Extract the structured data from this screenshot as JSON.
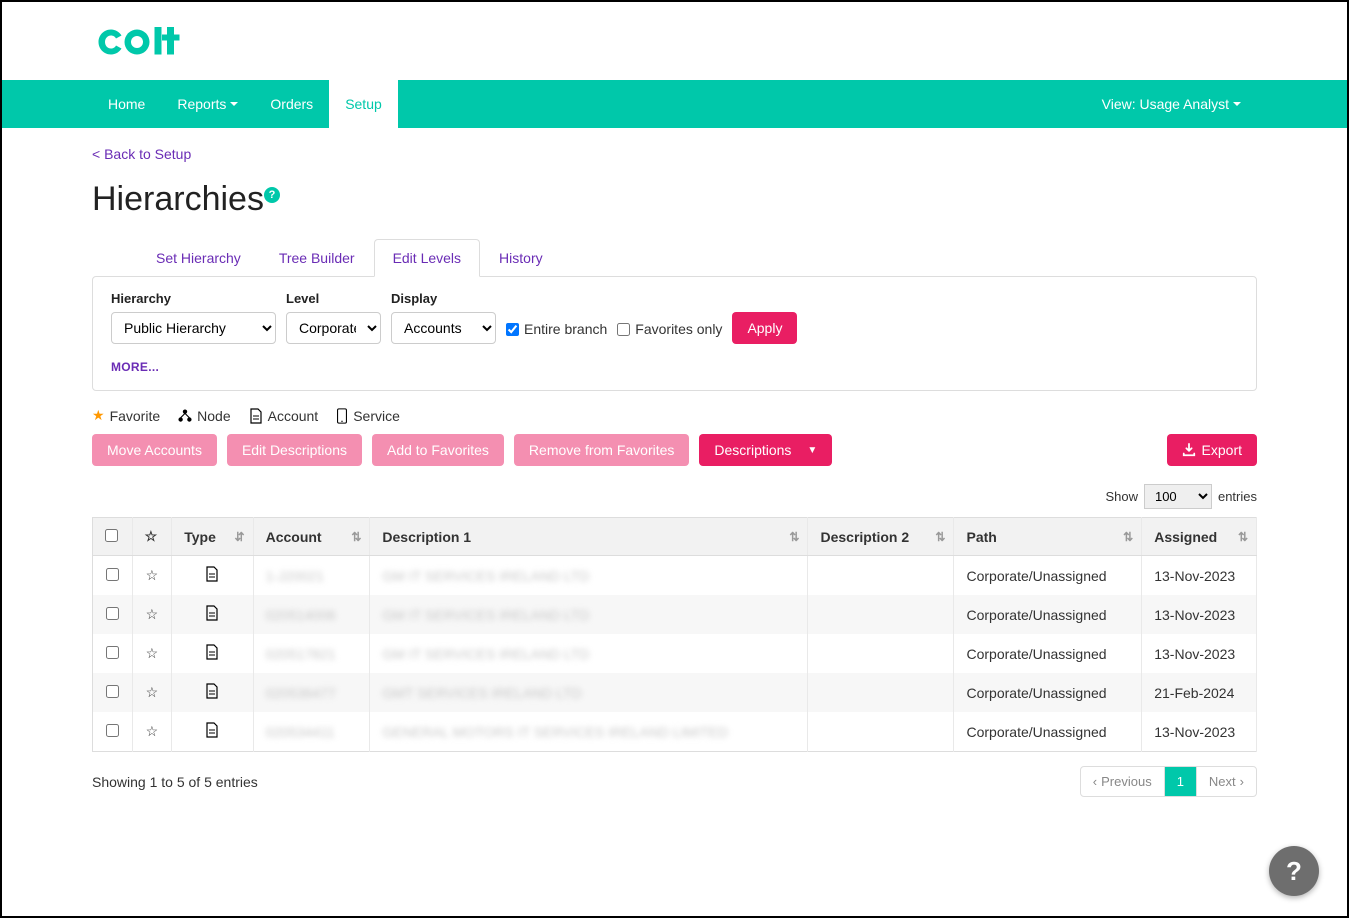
{
  "brand": {
    "name": "colt",
    "color": "#00c8aa"
  },
  "nav": {
    "left": [
      "Home",
      "Reports",
      "Orders",
      "Setup"
    ],
    "active": "Setup",
    "dropdowns": [
      "Reports"
    ],
    "right": "View: Usage Analyst"
  },
  "back_link": "< Back to Setup",
  "page_title": "Hierarchies",
  "tabs": [
    "Set Hierarchy",
    "Tree Builder",
    "Edit Levels",
    "History"
  ],
  "active_tab": "Edit Levels",
  "filters": {
    "hierarchy": {
      "label": "Hierarchy",
      "selected": "Public Hierarchy"
    },
    "level": {
      "label": "Level",
      "selected": "Corporate"
    },
    "display": {
      "label": "Display",
      "selected": "Accounts"
    },
    "entire_branch": {
      "label": "Entire branch",
      "checked": true
    },
    "favorites_only": {
      "label": "Favorites only",
      "checked": false
    },
    "apply": "Apply",
    "more": "MORE..."
  },
  "legend": {
    "favorite": "Favorite",
    "node": "Node",
    "account": "Account",
    "service": "Service"
  },
  "actions": {
    "move_accounts": "Move Accounts",
    "edit_descriptions": "Edit Descriptions",
    "add_favorites": "Add to Favorites",
    "remove_favorites": "Remove from Favorites",
    "descriptions": "Descriptions",
    "export": "Export"
  },
  "table": {
    "show_label_pre": "Show",
    "show_value": "100",
    "show_label_post": "entries",
    "headers": {
      "type": "Type",
      "account": "Account",
      "desc1": "Description 1",
      "desc2": "Description 2",
      "path": "Path",
      "assigned": "Assigned"
    },
    "rows": [
      {
        "account": "1-J20021",
        "desc1": "GM IT SERVICES IRELAND LTD",
        "desc2": "",
        "path": "Corporate/Unassigned",
        "assigned": "13-Nov-2023"
      },
      {
        "account": "020514006",
        "desc1": "GM IT SERVICES IRELAND LTD",
        "desc2": "",
        "path": "Corporate/Unassigned",
        "assigned": "13-Nov-2023"
      },
      {
        "account": "020517821",
        "desc1": "GM IT SERVICES IRELAND LTD",
        "desc2": "",
        "path": "Corporate/Unassigned",
        "assigned": "13-Nov-2023"
      },
      {
        "account": "020536477",
        "desc1": "GMT SERVICES IRELAND LTD",
        "desc2": "",
        "path": "Corporate/Unassigned",
        "assigned": "21-Feb-2024"
      },
      {
        "account": "020534411",
        "desc1": "GENERAL MOTORS IT SERVICES IRELAND LIMITED",
        "desc2": "",
        "path": "Corporate/Unassigned",
        "assigned": "13-Nov-2023"
      }
    ],
    "footer_info": "Showing 1 to 5 of 5 entries",
    "pager": {
      "previous": "Previous",
      "current": "1",
      "next": "Next"
    }
  }
}
